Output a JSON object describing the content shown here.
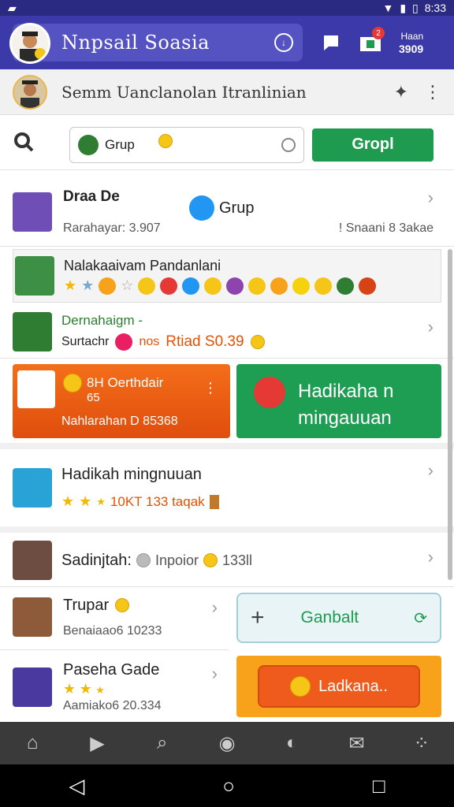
{
  "status": {
    "time": "8:33"
  },
  "appbar": {
    "title": "Nnpsail Soasia",
    "balance_top": "Haan",
    "balance_bottom": "3909"
  },
  "profile": {
    "name": "Semm Uanclanolan Itranlinian"
  },
  "search": {
    "value": "Grup",
    "button": "Gropl"
  },
  "rows": {
    "r1_title": "Draa De",
    "r1_group": "Grup",
    "r1_sub_left": "Rarahayar: 3.907",
    "r1_sub_right": "! Snaani 8 3akae",
    "r2_title": "Nalakaaivam Pandanlani",
    "r3_title": "Dernahaigm -",
    "r3_sub1": "Surtachr",
    "r3_sub2": "nos",
    "r3_price": "Rtiad S0.39",
    "orange_title": "8H Oerthdair",
    "orange_sub": "65",
    "orange_bottom": "Nahlarahan D 85368",
    "green_line1": "Hadikaha n",
    "green_line2": "mingauuan",
    "r4_title": "Hadikah mingnuuan",
    "r4_sub": "10KT 133 taqak",
    "r5_title": "Sadinjtah:",
    "r5_sub": "Inpoior",
    "r5_num": "133ll",
    "r6_title": "Trupar",
    "r6_sub": "Benaiaao6 10233",
    "r6_button": "Ganbalt",
    "r7_title": "Paseha Gade",
    "r7_sub": "Aamiako6 20.334",
    "r7_button": "Ladkana.."
  },
  "colors": {
    "header": "#3c3aa8",
    "green": "#1e9b4f",
    "orange": "#ef5b1c"
  }
}
